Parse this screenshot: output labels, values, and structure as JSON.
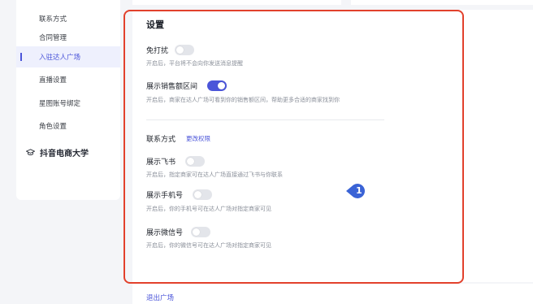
{
  "sidebar": {
    "items": [
      {
        "label": "联系方式"
      },
      {
        "label": "合同管理"
      },
      {
        "label": "入驻达人广场"
      },
      {
        "label": "直播设置"
      },
      {
        "label": "星图账号绑定"
      },
      {
        "label": "角色设置"
      }
    ],
    "section_label": "抖音电商大学"
  },
  "settings": {
    "title": "设置",
    "dnd": {
      "label": "免打扰",
      "desc": "开启后，平台将不会向你发送消息提醒",
      "on": false
    },
    "sales": {
      "label": "展示销售额区间",
      "desc": "开启后，商家在达人广场可看到你的销售额区间，帮助更多合适的商家找到你",
      "on": true
    }
  },
  "contact": {
    "title": "联系方式",
    "change_link": "更改权限",
    "feishu": {
      "label": "展示飞书",
      "desc": "开启后，指定商家可在达人广场直接通过飞书与你联系",
      "on": false
    },
    "phone": {
      "label": "展示手机号",
      "desc": "开启后，你的手机号可在达人广场对指定商家可见",
      "on": false
    },
    "wechat": {
      "label": "展示微信号",
      "desc": "开启后，你的微信号可在达人广场对指定商家可见",
      "on": false
    }
  },
  "annotation": {
    "number": "1"
  },
  "footer": {
    "logout": "退出广场"
  },
  "colors": {
    "accent": "#4b55d9",
    "highlight_border": "#e2412c",
    "badge": "#3a63d6"
  }
}
